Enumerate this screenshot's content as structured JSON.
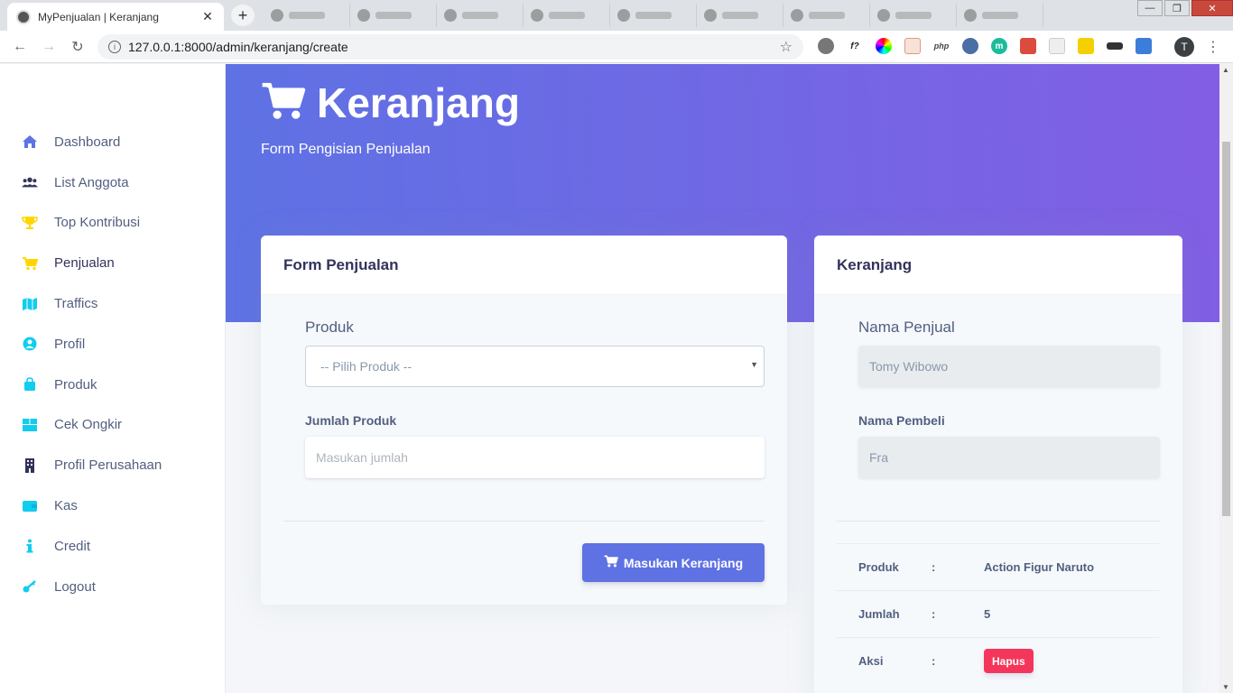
{
  "browser": {
    "tab_title": "MyPenjualan | Keranjang",
    "url": "127.0.0.1:8000/admin/keranjang/create",
    "profile_initial": "T"
  },
  "sidebar": {
    "items": [
      {
        "label": "Dashboard",
        "icon": "home-icon",
        "color": "#5e72e4"
      },
      {
        "label": "List Anggota",
        "icon": "users-icon",
        "color": "#32325d"
      },
      {
        "label": "Top Kontribusi",
        "icon": "trophy-icon",
        "color": "#ffd600"
      },
      {
        "label": "Penjualan",
        "icon": "cart-icon",
        "color": "#ffd600"
      },
      {
        "label": "Traffics",
        "icon": "map-icon",
        "color": "#11cdef"
      },
      {
        "label": "Profil",
        "icon": "user-circle-icon",
        "color": "#11cdef"
      },
      {
        "label": "Produk",
        "icon": "shopping-bag-icon",
        "color": "#11cdef"
      },
      {
        "label": "Cek Ongkir",
        "icon": "box-icon",
        "color": "#11cdef"
      },
      {
        "label": "Profil Perusahaan",
        "icon": "building-icon",
        "color": "#32325d"
      },
      {
        "label": "Kas",
        "icon": "wallet-icon",
        "color": "#11cdef"
      },
      {
        "label": "Credit",
        "icon": "info-icon",
        "color": "#11cdef"
      },
      {
        "label": "Logout",
        "icon": "key-icon",
        "color": "#11cdef"
      }
    ]
  },
  "header": {
    "title": "Keranjang",
    "subtitle": "Form Pengisian Penjualan"
  },
  "form_card": {
    "title": "Form Penjualan",
    "produk_label": "Produk",
    "produk_selected": "-- Pilih Produk --",
    "jumlah_label": "Jumlah Produk",
    "jumlah_placeholder": "Masukan jumlah",
    "submit_label": "Masukan Keranjang"
  },
  "cart_card": {
    "title": "Keranjang",
    "penjual_label": "Nama Penjual",
    "penjual_value": "Tomy Wibowo",
    "pembeli_label": "Nama Pembeli",
    "pembeli_value": "Fra",
    "rows": [
      {
        "key": "Produk",
        "sep": ":",
        "value": "Action Figur Naruto"
      },
      {
        "key": "Jumlah",
        "sep": ":",
        "value": "5"
      },
      {
        "key": "Aksi",
        "sep": ":",
        "action_label": "Hapus"
      }
    ]
  },
  "colors": {
    "primary": "#5e72e4",
    "danger": "#f5365c",
    "gradient_end": "#825ee4"
  }
}
